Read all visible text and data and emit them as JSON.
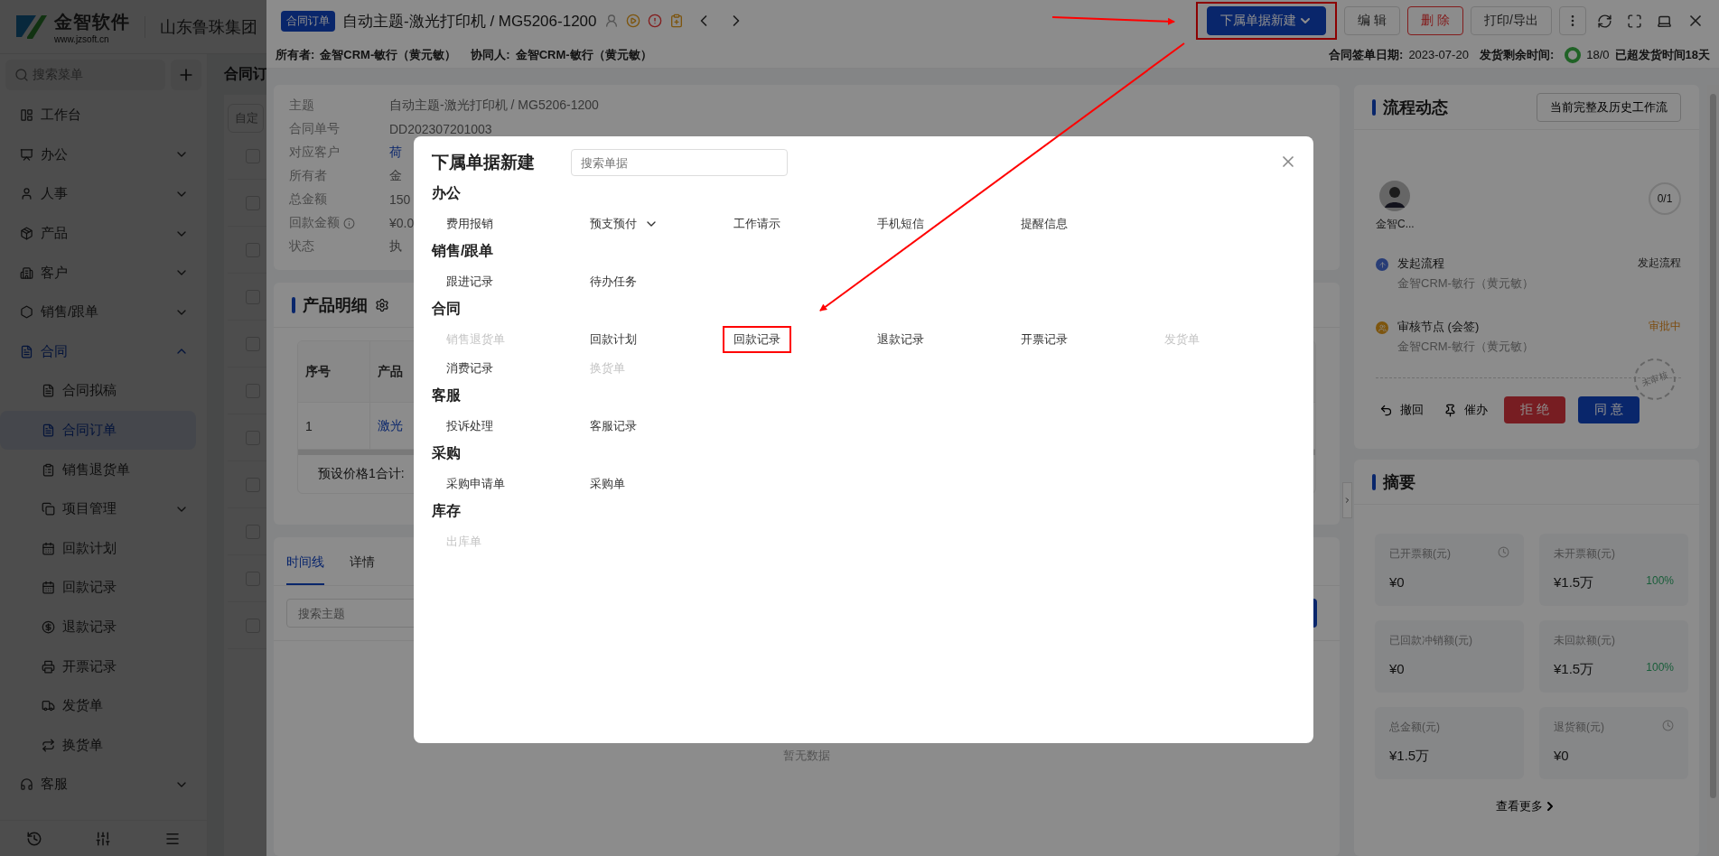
{
  "app": {
    "logo_text": "金智软件",
    "logo_url": "www.jzsoft.cn",
    "company": "山东鲁珠集团"
  },
  "sidebar": {
    "search_placeholder": "搜索菜单",
    "items": [
      {
        "label": "工作台",
        "selected": false
      },
      {
        "label": "办公",
        "selected": false,
        "expanded": false
      },
      {
        "label": "人事",
        "selected": false,
        "expanded": false
      },
      {
        "label": "产品",
        "selected": false,
        "expanded": false
      },
      {
        "label": "客户",
        "selected": false,
        "expanded": false
      },
      {
        "label": "销售/跟单",
        "selected": false,
        "expanded": false
      },
      {
        "label": "合同",
        "selected": true,
        "expanded": true,
        "children": [
          {
            "label": "合同拟稿",
            "selected": false
          },
          {
            "label": "合同订单",
            "selected": true
          },
          {
            "label": "销售退货单",
            "selected": false
          },
          {
            "label": "项目管理",
            "selected": false,
            "expanded": false
          },
          {
            "label": "回款计划",
            "selected": false
          },
          {
            "label": "回款记录",
            "selected": false
          },
          {
            "label": "退款记录",
            "selected": false
          },
          {
            "label": "开票记录",
            "selected": false
          },
          {
            "label": "发货单",
            "selected": false
          },
          {
            "label": "换货单",
            "selected": false
          }
        ]
      },
      {
        "label": "客服",
        "selected": false,
        "expanded": false
      }
    ]
  },
  "list_page": {
    "title": "合同订",
    "filter_label": "自定",
    "rows": [
      {
        "checked": false
      },
      {
        "checked": false
      },
      {
        "checked": false
      },
      {
        "checked": false
      },
      {
        "checked": false
      },
      {
        "checked": false
      },
      {
        "checked": false
      },
      {
        "checked": false
      },
      {
        "checked": false
      },
      {
        "checked": false
      },
      {
        "checked": false
      }
    ]
  },
  "drawer": {
    "tag": "合同订单",
    "title": "自动主题-激光打印机 / MG5206-1200",
    "actions": [
      {
        "label": "下属单据新建",
        "kind": "primary",
        "marked": true
      },
      {
        "label": "编 辑",
        "kind": "default",
        "marked": false
      },
      {
        "label": "删 除",
        "kind": "danger",
        "marked": false
      },
      {
        "label": "打印/导出",
        "kind": "default",
        "marked": false
      }
    ],
    "owner_label": "所有者:",
    "owner": "金智CRM-敏行（黄元敏）",
    "collab_label": "协同人:",
    "collab": "金智CRM-敏行（黄元敏）",
    "sign_label": "合同签单日期:",
    "sign_date": "2023-07-20",
    "remain_label": "发货剩余时间:",
    "remain": "18/0",
    "overdue": "已超发货时间18天"
  },
  "info": [
    {
      "label": "主题",
      "value": "自动主题-激光打印机 / MG5206-1200",
      "link": false
    },
    {
      "label": "合同单号",
      "value": "DD202307201003",
      "link": false
    },
    {
      "label": "对应客户",
      "value": "荷",
      "link": true
    },
    {
      "label": "所有者",
      "value": "金",
      "link": false
    },
    {
      "label": "总金额",
      "value": "150",
      "link": false
    },
    {
      "label": "回款金额",
      "value": "¥0.0",
      "link": false,
      "info": true
    },
    {
      "label": "状态",
      "value": "执",
      "link": false
    }
  ],
  "products": {
    "title": "产品明细",
    "columns": [
      "序号",
      "产品"
    ],
    "rows": [
      [
        "1",
        "激光"
      ]
    ],
    "footer": "预设价格1合计:"
  },
  "timeline": {
    "tabs": [
      {
        "label": "时间线",
        "selected": true
      },
      {
        "label": "详情",
        "selected": false
      }
    ],
    "search_placeholder": "搜索主题",
    "empty": "暂无数据"
  },
  "flow": {
    "title": "流程动态",
    "history_button": "当前完整及历史工作流",
    "approver": "金智C...",
    "count": "0/1",
    "steps": [
      {
        "title": "发起流程",
        "person": "金智CRM-敏行（黄元敏）",
        "status": "发起流程",
        "kind": "start"
      },
      {
        "title": "审核节点 (会签)",
        "person": "金智CRM-敏行（黄元敏）",
        "status": "审批中",
        "kind": "review"
      }
    ],
    "stamp": "未审核",
    "actions": [
      {
        "label": "撤回",
        "kind": "undo"
      },
      {
        "label": "催办",
        "kind": "urge"
      },
      {
        "label": "拒 绝",
        "kind": "reject"
      },
      {
        "label": "同 意",
        "kind": "approve"
      }
    ]
  },
  "summary": {
    "title": "摘要",
    "stats": [
      {
        "label": "已开票额(元)",
        "value": "¥0",
        "clock": true
      },
      {
        "label": "未开票额(元)",
        "value": "¥1.5万",
        "percent": "100%"
      },
      {
        "label": "已回款冲销额(元)",
        "value": "¥0"
      },
      {
        "label": "未回款额(元)",
        "value": "¥1.5万",
        "percent": "100%"
      },
      {
        "label": "总金额(元)",
        "value": "¥1.5万"
      },
      {
        "label": "退货额(元)",
        "value": "¥0",
        "clock": true
      }
    ],
    "more": "查看更多"
  },
  "modal": {
    "title": "下属单据新建",
    "search_placeholder": "搜索单据",
    "sections": [
      {
        "title": "办公",
        "items": [
          {
            "label": "费用报销",
            "disabled": false
          },
          {
            "label": "预支预付",
            "disabled": false,
            "dropdown": true
          },
          {
            "label": "工作请示",
            "disabled": false
          },
          {
            "label": "手机短信",
            "disabled": false
          },
          {
            "label": "提醒信息",
            "disabled": false
          }
        ]
      },
      {
        "title": "销售/跟单",
        "items": [
          {
            "label": "跟进记录",
            "disabled": false
          },
          {
            "label": "待办任务",
            "disabled": false
          }
        ]
      },
      {
        "title": "合同",
        "items": [
          {
            "label": "销售退货单",
            "disabled": true
          },
          {
            "label": "回款计划",
            "disabled": false
          },
          {
            "label": "回款记录",
            "disabled": false,
            "marked": true
          },
          {
            "label": "退款记录",
            "disabled": false
          },
          {
            "label": "开票记录",
            "disabled": false
          },
          {
            "label": "发货单",
            "disabled": true
          },
          {
            "label": "消费记录",
            "disabled": false
          },
          {
            "label": "换货单",
            "disabled": true
          }
        ]
      },
      {
        "title": "客服",
        "items": [
          {
            "label": "投诉处理",
            "disabled": false
          },
          {
            "label": "客服记录",
            "disabled": false
          }
        ]
      },
      {
        "title": "采购",
        "items": [
          {
            "label": "采购申请单",
            "disabled": false
          },
          {
            "label": "采购单",
            "disabled": false
          }
        ]
      },
      {
        "title": "库存",
        "items": [
          {
            "label": "出库单",
            "disabled": true
          }
        ]
      }
    ]
  }
}
